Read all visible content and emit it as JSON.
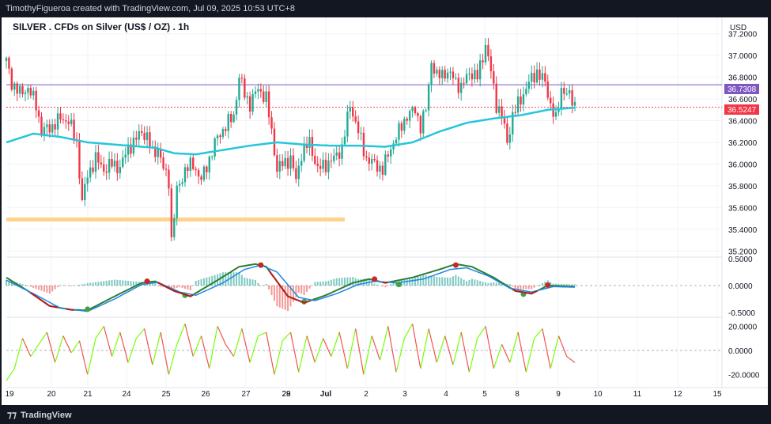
{
  "watermark": "TimothyFigueroa created with TradingView.com, Jul 09, 2025 10:53 UTC+8",
  "symbol_title": "SILVER . CFDs on Silver (US$ / OZ) . 1h",
  "currency": "USD",
  "price_labels": {
    "resistance": "36.7308",
    "last": "36.5247"
  },
  "brand": "TradingView",
  "colors": {
    "up": "#22ab94",
    "down": "#f23645",
    "ema": "#26c6da",
    "support_zone": "#ffd28a",
    "resistance_line": "#7e57c2",
    "macd_line": "#2e7d32",
    "signal_line": "#1e88e5",
    "momentum_up": "#76ff03",
    "momentum_down": "#ef5350"
  },
  "chart_data": [
    {
      "type": "candlestick",
      "title": "SILVER . CFDs on Silver (US$ / OZ) . 1h",
      "ylabel": "USD",
      "ylim": [
        35.1,
        37.3
      ],
      "y_ticks": [
        "37.2000",
        "37.0000",
        "36.8000",
        "36.6000",
        "36.4000",
        "36.2000",
        "36.0000",
        "35.8000",
        "35.6000",
        "35.4000",
        "35.2000"
      ],
      "x_ticks": [
        "19",
        "20",
        "21",
        "24",
        "25",
        "26",
        "27",
        "28",
        "29",
        "Jul",
        "2",
        "3",
        "4",
        "5",
        "8",
        "9",
        "10",
        "11",
        "12",
        "15"
      ],
      "close_path": [
        [
          0,
          36.95
        ],
        [
          2,
          36.75
        ],
        [
          5,
          36.65
        ],
        [
          8,
          36.7
        ],
        [
          11,
          36.55
        ],
        [
          13,
          36.3
        ],
        [
          17,
          36.35
        ],
        [
          20,
          36.42
        ],
        [
          23,
          36.4
        ],
        [
          26,
          36.2
        ],
        [
          28,
          35.65
        ],
        [
          30,
          35.9
        ],
        [
          33,
          36.05
        ],
        [
          36,
          35.95
        ],
        [
          39,
          36.0
        ],
        [
          42,
          35.97
        ],
        [
          45,
          36.15
        ],
        [
          47,
          36.2
        ],
        [
          50,
          36.3
        ],
        [
          52,
          36.25
        ],
        [
          54,
          36.1
        ],
        [
          56,
          36.15
        ],
        [
          58,
          35.95
        ],
        [
          60,
          35.85
        ],
        [
          61,
          35.3
        ],
        [
          63,
          35.75
        ],
        [
          66,
          35.95
        ],
        [
          69,
          36.0
        ],
        [
          72,
          35.85
        ],
        [
          75,
          36.05
        ],
        [
          78,
          36.25
        ],
        [
          81,
          36.35
        ],
        [
          84,
          36.45
        ],
        [
          86,
          36.8
        ],
        [
          88,
          36.65
        ],
        [
          90,
          36.55
        ],
        [
          93,
          36.7
        ],
        [
          96,
          36.6
        ],
        [
          98,
          36.3
        ],
        [
          100,
          35.95
        ],
        [
          102,
          36.0
        ],
        [
          105,
          36.05
        ],
        [
          107,
          35.85
        ],
        [
          109,
          36.1
        ],
        [
          112,
          36.2
        ],
        [
          115,
          35.95
        ],
        [
          118,
          36.0
        ],
        [
          121,
          36.05
        ],
        [
          124,
          36.15
        ],
        [
          127,
          36.55
        ],
        [
          130,
          36.3
        ],
        [
          133,
          36.05
        ],
        [
          136,
          36.0
        ],
        [
          139,
          35.95
        ],
        [
          142,
          36.15
        ],
        [
          145,
          36.3
        ],
        [
          148,
          36.45
        ],
        [
          151,
          36.5
        ],
        [
          153,
          36.35
        ],
        [
          155,
          36.5
        ],
        [
          157,
          36.95
        ],
        [
          159,
          36.8
        ],
        [
          162,
          36.85
        ],
        [
          165,
          36.8
        ],
        [
          168,
          36.7
        ],
        [
          171,
          36.85
        ],
        [
          174,
          36.8
        ],
        [
          177,
          37.1
        ],
        [
          179,
          36.85
        ],
        [
          181,
          36.55
        ],
        [
          183,
          36.45
        ],
        [
          185,
          36.2
        ],
        [
          187,
          36.45
        ],
        [
          190,
          36.6
        ],
        [
          193,
          36.75
        ],
        [
          196,
          36.85
        ],
        [
          199,
          36.75
        ],
        [
          201,
          36.55
        ],
        [
          203,
          36.4
        ],
        [
          205,
          36.7
        ],
        [
          207,
          36.65
        ],
        [
          210,
          36.55
        ]
      ],
      "ema_path": [
        [
          0,
          36.2
        ],
        [
          10,
          36.28
        ],
        [
          20,
          36.25
        ],
        [
          30,
          36.2
        ],
        [
          40,
          36.18
        ],
        [
          55,
          36.15
        ],
        [
          62,
          36.1
        ],
        [
          70,
          36.09
        ],
        [
          80,
          36.13
        ],
        [
          90,
          36.17
        ],
        [
          100,
          36.2
        ],
        [
          110,
          36.18
        ],
        [
          120,
          36.17
        ],
        [
          130,
          36.17
        ],
        [
          140,
          36.16
        ],
        [
          150,
          36.2
        ],
        [
          160,
          36.3
        ],
        [
          170,
          36.38
        ],
        [
          180,
          36.42
        ],
        [
          190,
          36.45
        ],
        [
          200,
          36.5
        ],
        [
          210,
          36.52
        ]
      ],
      "support_zone": {
        "from_x": 0,
        "to_x": 125,
        "y": 35.49
      },
      "resistance_level": 36.7308,
      "last_price": 36.5247
    },
    {
      "type": "line",
      "ylabel": "",
      "ylim": [
        -0.6,
        0.6
      ],
      "y_ticks": [
        "0.5000",
        "0.0000",
        "-0.5000"
      ],
      "series": [
        {
          "values_path": [
            [
              0,
              0.15
            ],
            [
              8,
              -0.1
            ],
            [
              16,
              -0.38
            ],
            [
              24,
              -0.45
            ],
            [
              30,
              -0.46
            ],
            [
              40,
              -0.2
            ],
            [
              50,
              0.05
            ],
            [
              55,
              0.08
            ],
            [
              62,
              -0.1
            ],
            [
              68,
              -0.2
            ],
            [
              78,
              0.1
            ],
            [
              86,
              0.35
            ],
            [
              92,
              0.4
            ],
            [
              96,
              0.35
            ],
            [
              104,
              -0.2
            ],
            [
              110,
              -0.32
            ],
            [
              118,
              -0.18
            ],
            [
              128,
              0.05
            ],
            [
              134,
              0.12
            ],
            [
              140,
              0.05
            ],
            [
              150,
              0.15
            ],
            [
              160,
              0.3
            ],
            [
              166,
              0.4
            ],
            [
              172,
              0.35
            ],
            [
              180,
              0.15
            ],
            [
              188,
              -0.1
            ],
            [
              194,
              -0.15
            ],
            [
              200,
              0.0
            ],
            [
              210,
              -0.02
            ]
          ]
        },
        {
          "values_path": [
            [
              0,
              0.1
            ],
            [
              10,
              -0.15
            ],
            [
              20,
              -0.42
            ],
            [
              30,
              -0.48
            ],
            [
              40,
              -0.25
            ],
            [
              50,
              0.02
            ],
            [
              56,
              0.06
            ],
            [
              64,
              -0.12
            ],
            [
              70,
              -0.18
            ],
            [
              80,
              0.05
            ],
            [
              88,
              0.3
            ],
            [
              94,
              0.38
            ],
            [
              100,
              0.25
            ],
            [
              108,
              -0.22
            ],
            [
              114,
              -0.28
            ],
            [
              122,
              -0.15
            ],
            [
              130,
              0.02
            ],
            [
              136,
              0.08
            ],
            [
              144,
              0.05
            ],
            [
              154,
              0.12
            ],
            [
              164,
              0.3
            ],
            [
              170,
              0.33
            ],
            [
              178,
              0.18
            ],
            [
              186,
              -0.05
            ],
            [
              194,
              -0.12
            ],
            [
              202,
              -0.02
            ],
            [
              210,
              -0.03
            ]
          ]
        }
      ],
      "cross_markers": [
        [
          30,
          -0.44,
          "up"
        ],
        [
          52,
          0.08,
          "down"
        ],
        [
          66,
          -0.18,
          "up"
        ],
        [
          94,
          0.38,
          "down"
        ],
        [
          110,
          -0.3,
          "up"
        ],
        [
          136,
          0.12,
          "down"
        ],
        [
          145,
          0.02,
          "up"
        ],
        [
          166,
          0.38,
          "down"
        ],
        [
          191,
          -0.16,
          "up"
        ],
        [
          200,
          0.01,
          "down"
        ]
      ]
    },
    {
      "type": "line",
      "ylabel": "",
      "ylim": [
        -28,
        28
      ],
      "y_ticks": [
        "20.0000",
        "0.0000",
        "-20.0000"
      ],
      "series": [
        {
          "name": "",
          "values_path": [
            [
              0,
              -25
            ],
            [
              3,
              -15
            ],
            [
              6,
              10
            ],
            [
              9,
              -5
            ],
            [
              12,
              5
            ],
            [
              15,
              15
            ],
            [
              18,
              -10
            ],
            [
              21,
              12
            ],
            [
              24,
              -2
            ],
            [
              27,
              8
            ],
            [
              30,
              -20
            ],
            [
              33,
              10
            ],
            [
              36,
              20
            ],
            [
              39,
              -5
            ],
            [
              42,
              15
            ],
            [
              45,
              -10
            ],
            [
              48,
              10
            ],
            [
              51,
              18
            ],
            [
              54,
              -12
            ],
            [
              57,
              15
            ],
            [
              60,
              -20
            ],
            [
              63,
              5
            ],
            [
              66,
              22
            ],
            [
              69,
              -5
            ],
            [
              72,
              12
            ],
            [
              75,
              -15
            ],
            [
              78,
              20
            ],
            [
              81,
              5
            ],
            [
              84,
              -5
            ],
            [
              87,
              18
            ],
            [
              90,
              -10
            ],
            [
              93,
              12
            ],
            [
              96,
              15
            ],
            [
              99,
              -20
            ],
            [
              102,
              8
            ],
            [
              105,
              15
            ],
            [
              108,
              -18
            ],
            [
              111,
              12
            ],
            [
              114,
              -10
            ],
            [
              117,
              10
            ],
            [
              120,
              -5
            ],
            [
              123,
              15
            ],
            [
              126,
              -15
            ],
            [
              129,
              18
            ],
            [
              132,
              -20
            ],
            [
              135,
              12
            ],
            [
              138,
              -8
            ],
            [
              141,
              20
            ],
            [
              144,
              -18
            ],
            [
              147,
              10
            ],
            [
              150,
              22
            ],
            [
              153,
              -15
            ],
            [
              156,
              18
            ],
            [
              159,
              -10
            ],
            [
              162,
              12
            ],
            [
              165,
              -12
            ],
            [
              168,
              15
            ],
            [
              171,
              -18
            ],
            [
              174,
              10
            ],
            [
              177,
              20
            ],
            [
              180,
              -15
            ],
            [
              183,
              5
            ],
            [
              186,
              -10
            ],
            [
              189,
              15
            ],
            [
              192,
              -18
            ],
            [
              195,
              10
            ],
            [
              198,
              18
            ],
            [
              201,
              -15
            ],
            [
              204,
              12
            ],
            [
              207,
              -5
            ],
            [
              210,
              -10
            ]
          ]
        }
      ]
    }
  ]
}
